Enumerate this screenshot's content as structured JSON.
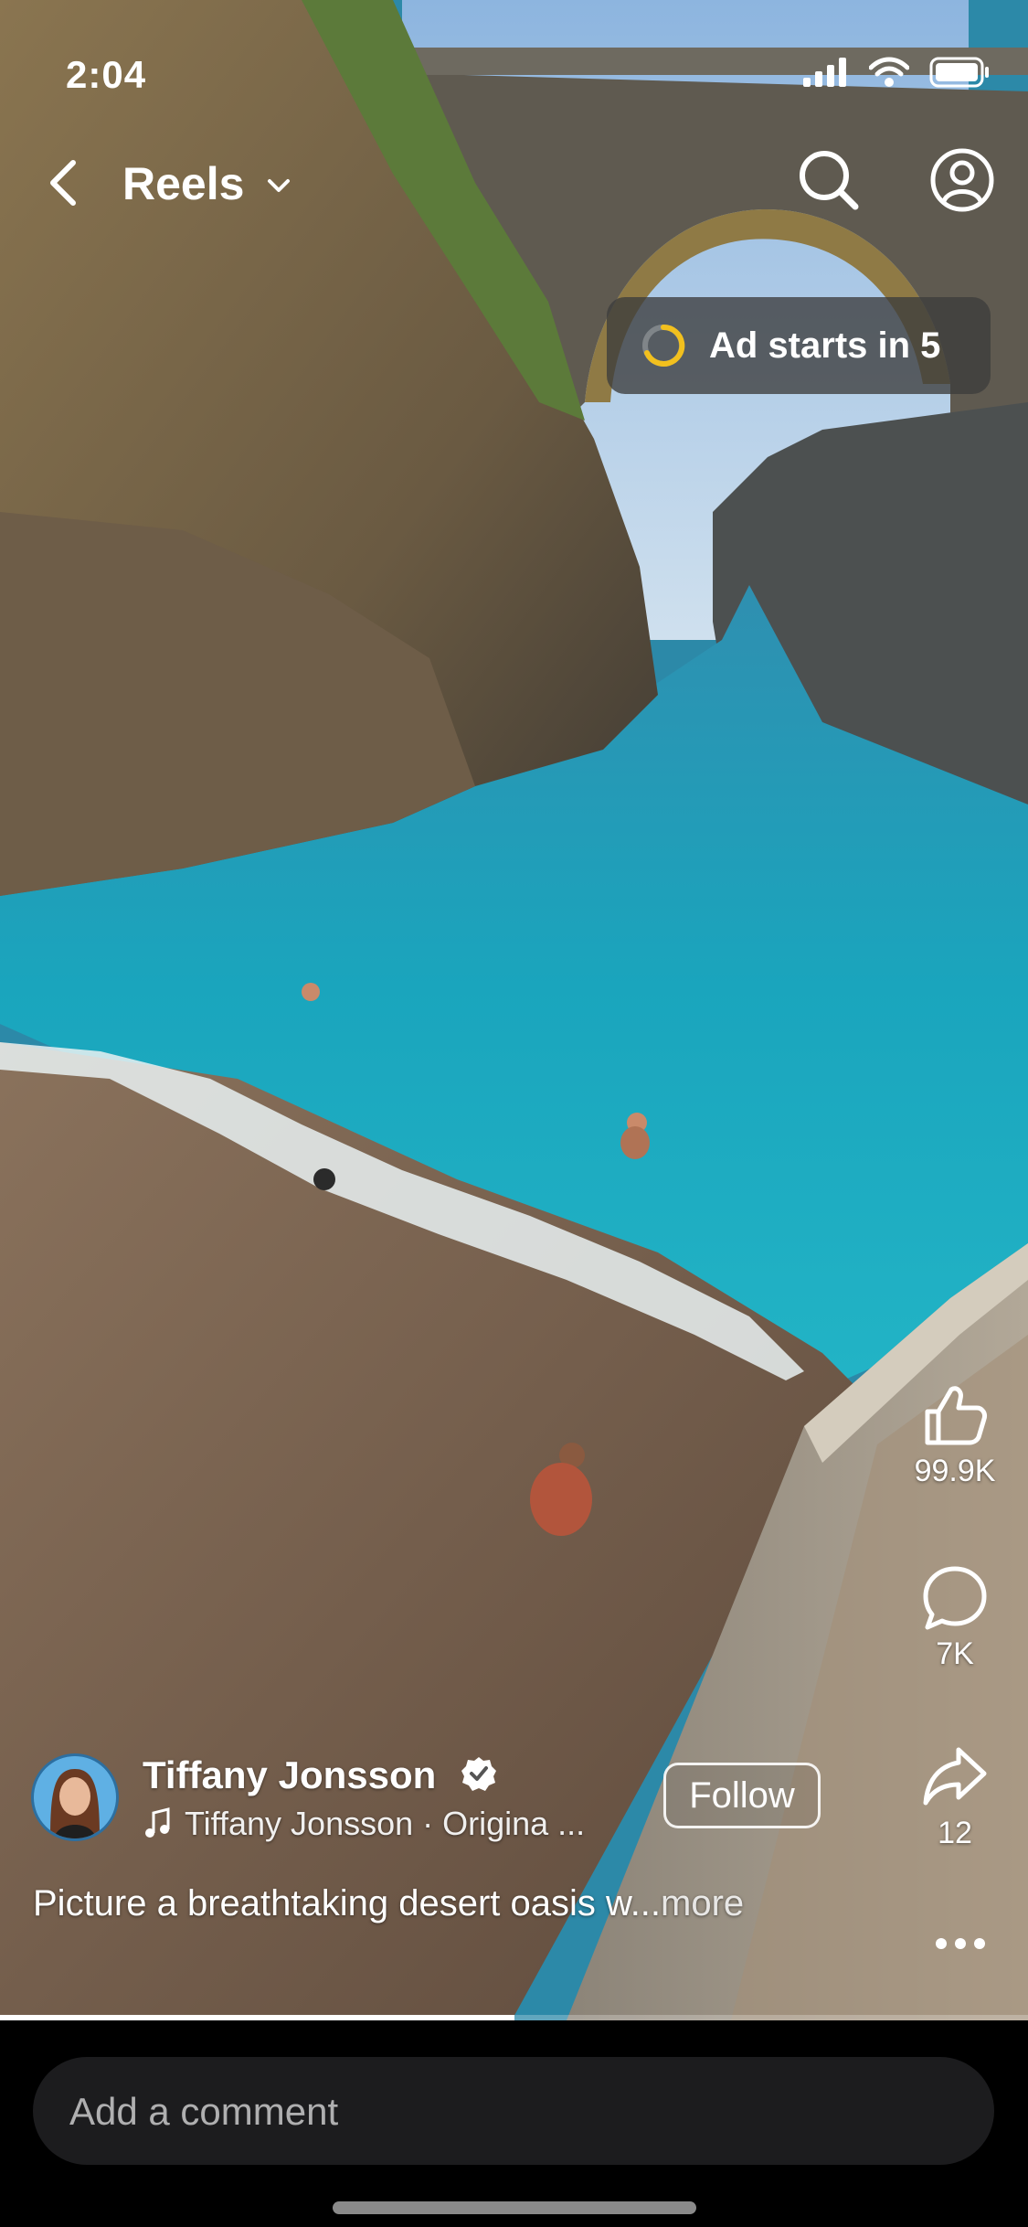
{
  "status_bar": {
    "time": "2:04"
  },
  "header": {
    "title": "Reels"
  },
  "ad_banner": {
    "text": "Ad starts in 5"
  },
  "actions": {
    "like_count": "99.9K",
    "comment_count": "7K",
    "share_count": "12"
  },
  "author": {
    "name": "Tiffany Jonsson",
    "audio": "Tiffany Jonsson · Origina ..."
  },
  "follow_label": "Follow",
  "caption": {
    "text": "Picture a breathtaking desert oasis w...",
    "more": "more"
  },
  "playback": {
    "progress_percent": 50
  },
  "comment": {
    "placeholder": "Add a comment"
  },
  "icons": [
    "back-icon",
    "chevron-down-icon",
    "search-icon",
    "profile-icon",
    "like-icon",
    "comment-icon",
    "share-icon",
    "more-icon",
    "verified-icon",
    "music-note-icon",
    "signal-icon",
    "wifi-icon",
    "battery-icon"
  ],
  "colors": {
    "ad_spinner": "#f2c01e",
    "background": "#000000",
    "comment_box": "#1c1c1e"
  }
}
